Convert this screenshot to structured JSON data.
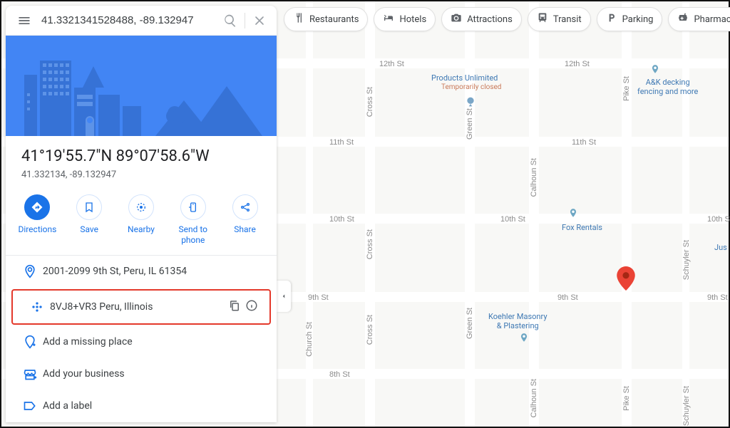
{
  "search": {
    "query": "41.3321341528488, -89.132947"
  },
  "chips": {
    "restaurants": "Restaurants",
    "hotels": "Hotels",
    "attractions": "Attractions",
    "transit": "Transit",
    "parking": "Parking",
    "pharmacies": "Pharmacies"
  },
  "title": {
    "dms": "41°19'55.7\"N 89°07'58.6\"W",
    "decimal": "41.332134, -89.132947"
  },
  "actions": {
    "directions": "Directions",
    "save": "Save",
    "nearby": "Nearby",
    "send": "Send to phone",
    "share": "Share"
  },
  "details": {
    "address": "2001-2099 9th St, Peru, IL 61354",
    "plus_code": "8VJ8+VR3 Peru, Illinois",
    "add_missing": "Add a missing place",
    "add_business": "Add your business",
    "add_label": "Add a label"
  },
  "roads": {
    "st12th": "12th St",
    "st11th": "11th St",
    "st10th": "10th St",
    "st9th": "9th St",
    "st8th": "8th St",
    "church": "Church St",
    "cross": "Cross St",
    "green": "Green St",
    "calhoun": "Calhoun St",
    "pike": "Pike St",
    "schuyler": "Schuyler St"
  },
  "poi": {
    "products_unlimited": "Products Unlimited",
    "products_unlimited_status": "Temporarily closed",
    "ak_decking": "A&K decking\nfencing and more",
    "fox_rentals": "Fox Rentals",
    "jus": "Jus",
    "koehler": "Koehler Masonry\n& Plastering"
  }
}
